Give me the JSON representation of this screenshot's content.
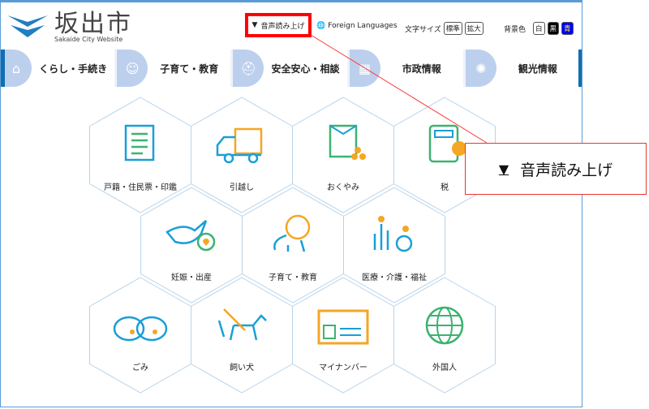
{
  "header": {
    "logo_text": "坂出市",
    "logo_subtitle": "Sakaide City Website",
    "voice_label": "音声読み上げ",
    "foreign_label": "Foreign Languages",
    "font_size_label": "文字サイズ",
    "font_size_options": [
      "標準",
      "拡大"
    ],
    "bg_color_label": "背景色",
    "bg_color_options": [
      "白",
      "黒",
      "青"
    ]
  },
  "nav": [
    {
      "label": "くらし・手続き",
      "icon": "home-icon"
    },
    {
      "label": "子育て・教育",
      "icon": "baby-icon"
    },
    {
      "label": "安全安心・相談",
      "icon": "helmet-icon"
    },
    {
      "label": "市政情報",
      "icon": "building-icon"
    },
    {
      "label": "観光情報",
      "icon": "firework-icon"
    }
  ],
  "tiles": [
    {
      "label": "戸籍・住民票・印鑑",
      "icon": "document-icon"
    },
    {
      "label": "引越し",
      "icon": "truck-icon"
    },
    {
      "label": "おくやみ",
      "icon": "condolence-icon"
    },
    {
      "label": "税",
      "icon": "calculator-icon"
    },
    {
      "label": "妊娠・出産",
      "icon": "stork-icon"
    },
    {
      "label": "子育て・教育",
      "icon": "child-icon"
    },
    {
      "label": "医療・介護・福祉",
      "icon": "wheelchair-icon"
    },
    {
      "label": "ごみ",
      "icon": "garbage-bag-icon"
    },
    {
      "label": "飼い犬",
      "icon": "dog-icon"
    },
    {
      "label": "マイナンバー",
      "icon": "id-card-icon"
    },
    {
      "label": "外国人",
      "icon": "globe-icon"
    }
  ],
  "callout": {
    "label": "音声読み上げ"
  },
  "colors": {
    "accent": "#0f6fb3",
    "nav_circle": "#bcd0ee",
    "highlight": "#ff0000",
    "icon_blue": "#1a9fd6",
    "icon_orange": "#f5a623",
    "icon_green": "#3cb371"
  }
}
